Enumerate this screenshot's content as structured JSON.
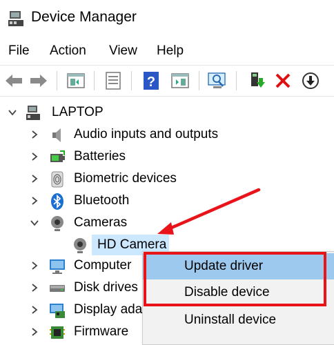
{
  "window": {
    "title": "Device Manager"
  },
  "menu": {
    "file": "File",
    "action": "Action",
    "view": "View",
    "help": "Help"
  },
  "tree": {
    "root": "LAPTOP",
    "items": [
      {
        "label": "Audio inputs and outputs",
        "icon": "speaker-icon"
      },
      {
        "label": "Batteries",
        "icon": "battery-icon"
      },
      {
        "label": "Biometric devices",
        "icon": "fingerprint-icon"
      },
      {
        "label": "Bluetooth",
        "icon": "bluetooth-icon"
      },
      {
        "label": "Cameras",
        "icon": "camera-icon",
        "expanded": true
      },
      {
        "label": "HD Camera",
        "icon": "webcam-icon",
        "child": true,
        "selected": true
      },
      {
        "label": "Computer",
        "icon": "monitor-icon"
      },
      {
        "label": "Disk drives",
        "icon": "disk-drive-icon"
      },
      {
        "label": "Display ada",
        "icon": "display-adapter-icon"
      },
      {
        "label": "Firmware",
        "icon": "firmware-icon"
      }
    ]
  },
  "context_menu": {
    "update_driver": "Update driver",
    "disable_device": "Disable device",
    "uninstall_device": "Uninstall device"
  },
  "colors": {
    "highlight": "#9ec9ee",
    "selection": "#cce8ff",
    "annotation_red": "#e8141a"
  }
}
